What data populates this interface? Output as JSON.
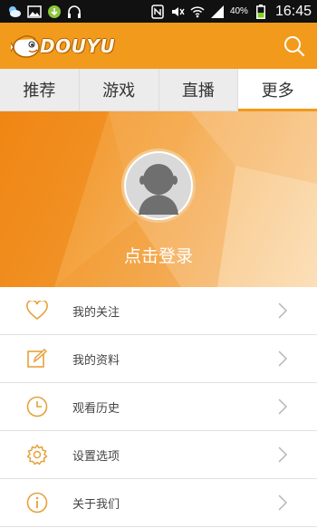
{
  "status_bar": {
    "battery_percent": "40%",
    "time": "16:45",
    "icons": [
      "weather-icon",
      "image-icon",
      "download-icon",
      "headphones-icon",
      "nfc-icon",
      "mute-icon",
      "wifi-icon",
      "signal-icon",
      "battery-icon"
    ]
  },
  "header": {
    "logo_text": "DOUYU",
    "search_icon": "search-icon",
    "accent_color": "#f29a1c"
  },
  "tabs": [
    {
      "label": "推荐",
      "active": false
    },
    {
      "label": "游戏",
      "active": false
    },
    {
      "label": "直播",
      "active": false
    },
    {
      "label": "更多",
      "active": true
    }
  ],
  "profile": {
    "login_label": "点击登录",
    "avatar_icon": "default-avatar-icon"
  },
  "menu": [
    {
      "label": "我的关注",
      "icon": "heart-icon"
    },
    {
      "label": "我的资料",
      "icon": "edit-icon"
    },
    {
      "label": "观看历史",
      "icon": "clock-icon"
    },
    {
      "label": "设置选项",
      "icon": "gear-icon"
    },
    {
      "label": "关于我们",
      "icon": "info-icon"
    }
  ]
}
